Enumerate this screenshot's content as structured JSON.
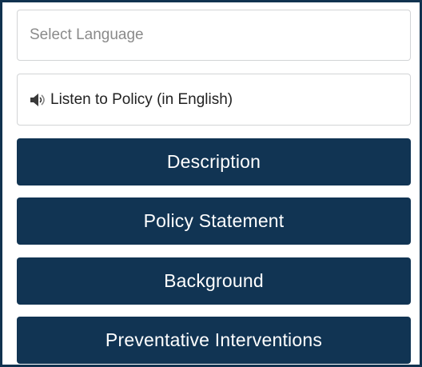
{
  "language_select": {
    "placeholder": "Select Language"
  },
  "listen": {
    "icon": "speaker-icon",
    "label": "Listen to Policy (in English)"
  },
  "sections": [
    {
      "label": "Description"
    },
    {
      "label": "Policy Statement"
    },
    {
      "label": "Background"
    },
    {
      "label": "Preventative Interventions"
    }
  ],
  "colors": {
    "button_bg": "#113453",
    "frame_border": "#11324f",
    "button_text": "#ffffff"
  }
}
